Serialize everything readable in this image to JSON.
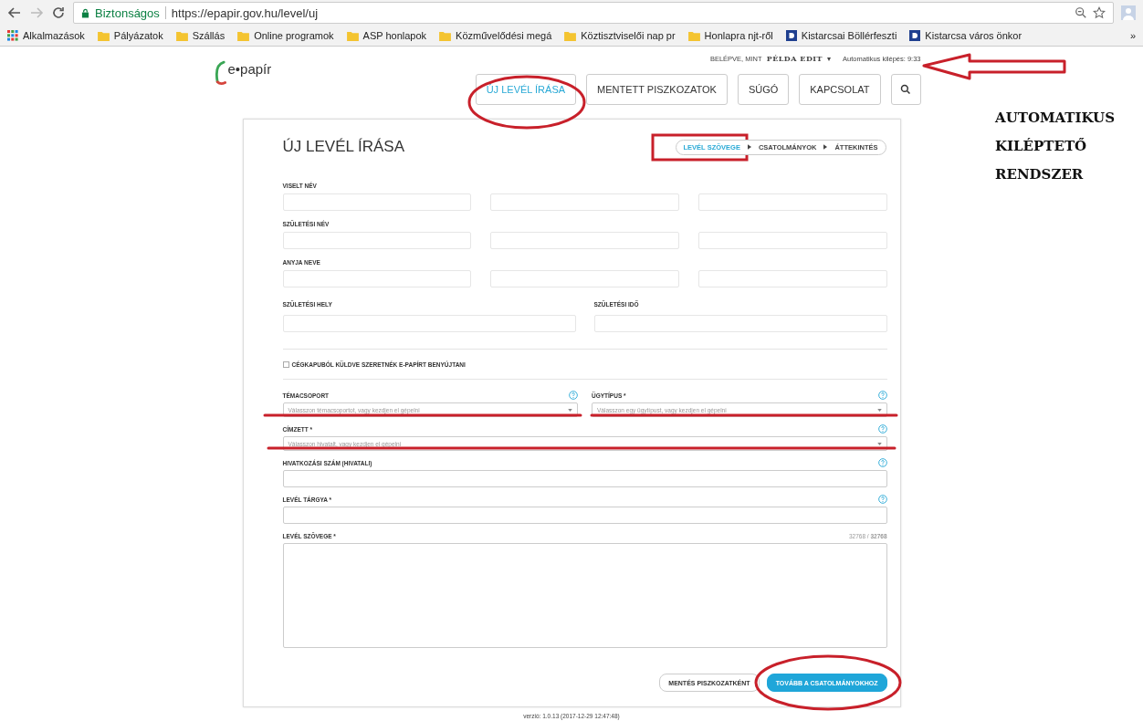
{
  "browser": {
    "secure_label": "Biztonságos",
    "url": "https://epapir.gov.hu/level/uj"
  },
  "bookmarks": [
    {
      "kind": "apps",
      "label": "Alkalmazások"
    },
    {
      "kind": "folder",
      "label": "Pályázatok"
    },
    {
      "kind": "folder",
      "label": "Szállás"
    },
    {
      "kind": "folder",
      "label": "Online programok"
    },
    {
      "kind": "folder",
      "label": "ASP honlapok"
    },
    {
      "kind": "folder",
      "label": "Közművelődési megá"
    },
    {
      "kind": "folder",
      "label": "Köztisztviselői nap pr"
    },
    {
      "kind": "folder",
      "label": "Honlapra njt-ről"
    },
    {
      "kind": "site",
      "label": "Kistarcsai Böllérfeszti"
    },
    {
      "kind": "site",
      "label": "Kistarcsa város önkor"
    }
  ],
  "bookmarks_more": "»",
  "logo": "e•papír",
  "user": {
    "prefix": "BELÉPVE, MINT",
    "name": "PÉLDA EDIT",
    "caret": "▾",
    "logout": "Automatikus kilépés: 9:33"
  },
  "nav": [
    {
      "label": "ÚJ LEVÉL ÍRÁSA",
      "selected": true
    },
    {
      "label": "MENTETT PISZKOZATOK",
      "selected": false
    },
    {
      "label": "SÚGÓ",
      "selected": false
    },
    {
      "label": "KAPCSOLAT",
      "selected": false
    }
  ],
  "title": "ÚJ LEVÉL ÍRÁSA",
  "steps": [
    {
      "label": "LEVÉL SZÖVEGE",
      "selected": true
    },
    {
      "label": "CSATOLMÁNYOK",
      "selected": false
    },
    {
      "label": "ÁTTEKINTÉS",
      "selected": false
    }
  ],
  "personal_rows": [
    {
      "kind": "triple",
      "label": "VISELT NÉV"
    },
    {
      "kind": "triple",
      "label": "SZÜLETÉSI NÉV"
    },
    {
      "kind": "triple",
      "label": "ANYJA NEVE"
    },
    {
      "kind": "pair",
      "labels": [
        "SZÜLETÉSI HELY",
        "SZÜLETÉSI IDŐ"
      ]
    }
  ],
  "company_checkbox": {
    "label": "CÉGKAPUBÓL KÜLDVE SZERETNÉK E-PAPÍRT BENYÚJTANI",
    "checked": false
  },
  "case_rows": [
    [
      {
        "kind": "select",
        "label": "TÉMACSOPORT",
        "placeholder": "Válasszon témacsoportot, vagy kezdjen el gépelni",
        "help": true
      },
      {
        "kind": "select",
        "label": "ÜGYTÍPUS *",
        "placeholder": "Válasszon egy ügytípust, vagy kezdjen el gépelni",
        "help": true
      }
    ],
    [
      {
        "kind": "select",
        "label": "CÍMZETT *",
        "placeholder": "Válasszon hivatalt, vagy kezdjen el gépelni",
        "help": true
      }
    ],
    [
      {
        "kind": "input",
        "label": "HIVATKOZÁSI SZÁM (HIVATALI)",
        "help": true
      }
    ],
    [
      {
        "kind": "input",
        "label": "LEVÉL TÁRGYA *",
        "help": true
      }
    ],
    [
      {
        "kind": "textarea",
        "label": "LEVÉL SZÖVEGE *",
        "help": false,
        "counter": "32768 / **32768**"
      }
    ]
  ],
  "buttons": [
    {
      "label": "MENTÉS PISZKOZATKÉNT",
      "kind": "secondary"
    },
    {
      "label": "TOVÁBB A CSATOLMÁNYOKHOZ",
      "kind": "primary"
    }
  ],
  "version": "verzió: 1.0.13 (2017-12-29 12:47:48)",
  "annotation_note": [
    "AUTOMATIKUS",
    "KILÉPTETŐ",
    "RENDSZER"
  ]
}
